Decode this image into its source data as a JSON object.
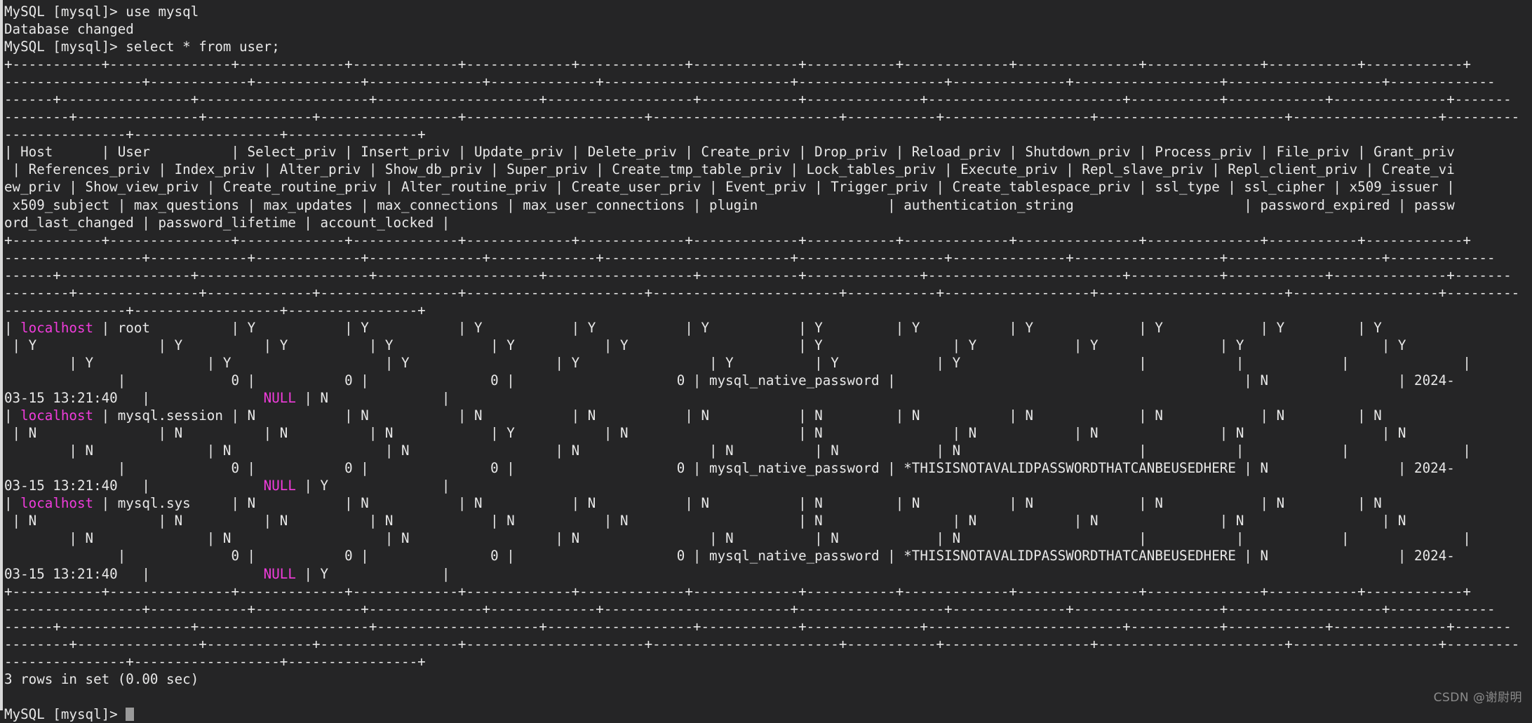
{
  "terminal": {
    "background_color": "#252526",
    "foreground_color": "#e8e8e8",
    "highlight_color": "#f13cdc",
    "watermark": "CSDN @谢尉明",
    "prompt": "MySQL [mysql]> ",
    "cursor": "block-cursor"
  },
  "session": {
    "commands": [
      {
        "prompt": "MySQL [mysql]> ",
        "command": "use mysql"
      },
      {
        "prompt": "MySQL [mysql]> ",
        "command": "select * from user;"
      }
    ],
    "messages": {
      "database_changed": "Database changed",
      "rows_in_set": "3 rows in set (0.00 sec)"
    }
  },
  "query_result": {
    "table": "user",
    "row_count": 3,
    "elapsed": "0.00 sec",
    "columns": [
      "Host",
      "User",
      "Select_priv",
      "Insert_priv",
      "Update_priv",
      "Delete_priv",
      "Create_priv",
      "Drop_priv",
      "Reload_priv",
      "Shutdown_priv",
      "Process_priv",
      "File_priv",
      "Grant_priv",
      "References_priv",
      "Index_priv",
      "Alter_priv",
      "Show_db_priv",
      "Super_priv",
      "Create_tmp_table_priv",
      "Lock_tables_priv",
      "Execute_priv",
      "Repl_slave_priv",
      "Repl_client_priv",
      "Create_view_priv",
      "Show_view_priv",
      "Create_routine_priv",
      "Alter_routine_priv",
      "Create_user_priv",
      "Event_priv",
      "Trigger_priv",
      "Create_tablespace_priv",
      "ssl_type",
      "ssl_cipher",
      "x509_issuer",
      "x509_subject",
      "max_questions",
      "max_updates",
      "max_connections",
      "max_user_connections",
      "plugin",
      "authentication_string",
      "password_expired",
      "password_last_changed",
      "password_lifetime",
      "account_locked"
    ],
    "rows": [
      {
        "Host": "localhost",
        "User": "root",
        "privileges": "Y",
        "plugin": "mysql_native_password",
        "authentication_string": "",
        "password_expired": "N",
        "password_last_changed": "2024-03-15 13:21:40",
        "password_lifetime": "NULL",
        "account_locked": "N",
        "max_questions": "0",
        "max_updates": "0",
        "max_connections": "0",
        "max_user_connections": "0"
      },
      {
        "Host": "localhost",
        "User": "mysql.session",
        "privileges": "N",
        "plugin": "mysql_native_password",
        "authentication_string": "*THISISNOTAVALIDPASSWORDTHATCANBEUSEDHERE",
        "password_expired": "N",
        "password_last_changed": "2024-03-15 13:21:40",
        "password_lifetime": "NULL",
        "account_locked": "Y",
        "max_questions": "0",
        "max_updates": "0",
        "max_connections": "0",
        "max_user_connections": "0"
      },
      {
        "Host": "localhost",
        "User": "mysql.sys",
        "privileges": "N",
        "plugin": "mysql_native_password",
        "authentication_string": "*THISISNOTAVALIDPASSWORDTHATCANBEUSEDHERE",
        "password_expired": "N",
        "password_last_changed": "2024-03-15 13:21:40",
        "password_lifetime": "NULL",
        "account_locked": "Y",
        "max_questions": "0",
        "max_updates": "0",
        "max_connections": "0",
        "max_user_connections": "0"
      }
    ]
  },
  "screen_lines": [
    {
      "id": "l01",
      "text": "MySQL [mysql]> use mysql"
    },
    {
      "id": "l02",
      "text": "Database changed"
    },
    {
      "id": "l03",
      "text": "MySQL [mysql]> select * from user;"
    },
    {
      "id": "l04",
      "text": "+-----------+---------------+-------------+-------------+-------------+-------------+-------------+-----------+-------------+---------------+--------------+-----------+------------+"
    },
    {
      "id": "l05",
      "text": "-----------------+------------+-------------+--------------+-------------+-----------------------+------------------+--------------+------------------+-------------------+-------------"
    },
    {
      "id": "l06",
      "text": "------+----------------+---------------------+--------------------+------------------+------------+--------------+------------------------+-----------+------------+--------------+-------"
    },
    {
      "id": "l07",
      "text": "--------+---------------+-------------+-----------------+----------------------+-----------------------+-----------+------------------+-----------------------+------------------+---------"
    },
    {
      "id": "l08",
      "text": "---------------+------------------+----------------+"
    },
    {
      "id": "l09",
      "text": "| Host      | User          | Select_priv | Insert_priv | Update_priv | Delete_priv | Create_priv | Drop_priv | Reload_priv | Shutdown_priv | Process_priv | File_priv | Grant_priv"
    },
    {
      "id": "l10",
      "text": " | References_priv | Index_priv | Alter_priv | Show_db_priv | Super_priv | Create_tmp_table_priv | Lock_tables_priv | Execute_priv | Repl_slave_priv | Repl_client_priv | Create_vi"
    },
    {
      "id": "l11",
      "text": "ew_priv | Show_view_priv | Create_routine_priv | Alter_routine_priv | Create_user_priv | Event_priv | Trigger_priv | Create_tablespace_priv | ssl_type | ssl_cipher | x509_issuer |"
    },
    {
      "id": "l12",
      "text": " x509_subject | max_questions | max_updates | max_connections | max_user_connections | plugin                | authentication_string                     | password_expired | passw"
    },
    {
      "id": "l13",
      "text": "ord_last_changed | password_lifetime | account_locked |"
    },
    {
      "id": "l14",
      "text": "+-----------+---------------+-------------+-------------+-------------+-------------+-------------+-----------+-------------+---------------+--------------+-----------+------------+"
    },
    {
      "id": "l15",
      "text": "-----------------+------------+-------------+--------------+-------------+-----------------------+------------------+--------------+------------------+-------------------+-------------"
    },
    {
      "id": "l16",
      "text": "------+----------------+---------------------+--------------------+------------------+------------+--------------+------------------------+-----------+------------+--------------+-------"
    },
    {
      "id": "l17",
      "text": "--------+---------------+-------------+-----------------+----------------------+-----------------------+-----------+------------------+-----------------------+------------------+---------"
    },
    {
      "id": "l18",
      "text": "---------------+------------------+----------------+"
    },
    {
      "id": "l19",
      "segments": [
        {
          "text": "| "
        },
        {
          "text": "localhost",
          "color": "magenta"
        },
        {
          "text": " | root          | Y           | Y           | Y           | Y           | Y           | Y         | Y           | Y             | Y            | Y         | Y"
        }
      ]
    },
    {
      "id": "l20",
      "text": " | Y               | Y          | Y          | Y            | Y           | Y                     | Y                | Y            | Y               | Y                 | Y"
    },
    {
      "id": "l21",
      "text": "        | Y              | Y                   | Y                  | Y                | Y          | Y            | Y                      |           |            |              |"
    },
    {
      "id": "l22",
      "text": "              |             0 |           0 |               0 |                    0 | mysql_native_password |                                           | N                | 2024-"
    },
    {
      "id": "l23",
      "segments": [
        {
          "text": "03-15 13:21:40   |              "
        },
        {
          "text": "NULL",
          "color": "magenta"
        },
        {
          "text": " | N              |"
        }
      ]
    },
    {
      "id": "l24",
      "segments": [
        {
          "text": "| "
        },
        {
          "text": "localhost",
          "color": "magenta"
        },
        {
          "text": " | mysql.session | N           | N           | N           | N           | N           | N         | N           | N             | N            | N         | N"
        }
      ]
    },
    {
      "id": "l25",
      "text": " | N               | N          | N          | N            | Y           | N                     | N                | N            | N               | N                 | N"
    },
    {
      "id": "l26",
      "text": "        | N              | N                   | N                  | N                | N          | N            | N                      |           |            |              |"
    },
    {
      "id": "l27",
      "text": "              |             0 |           0 |               0 |                    0 | mysql_native_password | *THISISNOTAVALIDPASSWORDTHATCANBEUSEDHERE | N                | 2024-"
    },
    {
      "id": "l28",
      "segments": [
        {
          "text": "03-15 13:21:40   |              "
        },
        {
          "text": "NULL",
          "color": "magenta"
        },
        {
          "text": " | Y              |"
        }
      ]
    },
    {
      "id": "l29",
      "segments": [
        {
          "text": "| "
        },
        {
          "text": "localhost",
          "color": "magenta"
        },
        {
          "text": " | mysql.sys     | N           | N           | N           | N           | N           | N         | N           | N             | N            | N         | N"
        }
      ]
    },
    {
      "id": "l30",
      "text": " | N               | N          | N          | N            | N           | N                     | N                | N            | N               | N                 | N"
    },
    {
      "id": "l31",
      "text": "        | N              | N                   | N                  | N                | N          | N            | N                      |           |            |              |"
    },
    {
      "id": "l32",
      "text": "              |             0 |           0 |               0 |                    0 | mysql_native_password | *THISISNOTAVALIDPASSWORDTHATCANBEUSEDHERE | N                | 2024-"
    },
    {
      "id": "l33",
      "segments": [
        {
          "text": "03-15 13:21:40   |              "
        },
        {
          "text": "NULL",
          "color": "magenta"
        },
        {
          "text": " | Y              |"
        }
      ]
    },
    {
      "id": "l34",
      "text": "+-----------+---------------+-------------+-------------+-------------+-------------+-------------+-----------+-------------+---------------+--------------+-----------+------------+"
    },
    {
      "id": "l35",
      "text": "-----------------+------------+-------------+--------------+-------------+-----------------------+------------------+--------------+------------------+-------------------+-------------"
    },
    {
      "id": "l36",
      "text": "------+----------------+---------------------+--------------------+------------------+------------+--------------+------------------------+-----------+------------+--------------+-------"
    },
    {
      "id": "l37",
      "text": "--------+---------------+-------------+-----------------+----------------------+-----------------------+-----------+------------------+-----------------------+------------------+---------"
    },
    {
      "id": "l38",
      "text": "---------------+------------------+----------------+"
    },
    {
      "id": "l39",
      "text": "3 rows in set (0.00 sec)"
    },
    {
      "id": "l40",
      "text": ""
    },
    {
      "id": "l41",
      "text": "MySQL [mysql]> ",
      "cursor": true
    }
  ]
}
